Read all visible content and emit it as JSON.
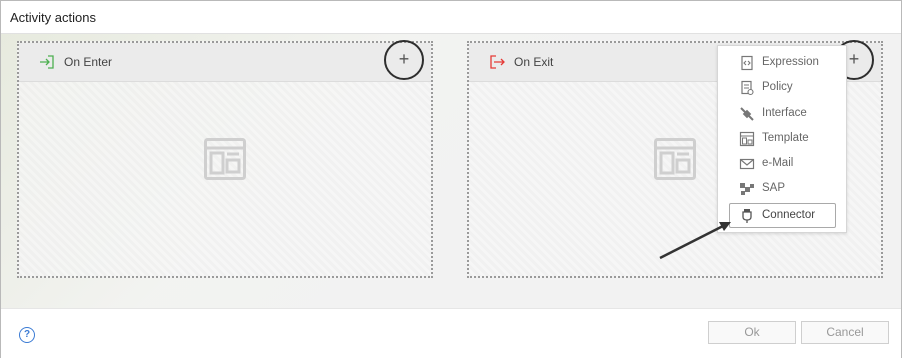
{
  "dialog": {
    "title": "Activity actions"
  },
  "panels": {
    "enter": {
      "label": "On Enter",
      "icon": "enter-arrow-icon",
      "add": "+"
    },
    "exit": {
      "label": "On Exit",
      "icon": "exit-arrow-icon",
      "add": "+"
    }
  },
  "menu": {
    "items": [
      {
        "label": "Expression",
        "icon": "expression-icon"
      },
      {
        "label": "Policy",
        "icon": "policy-icon"
      },
      {
        "label": "Interface",
        "icon": "interface-icon"
      },
      {
        "label": "Template",
        "icon": "template-icon"
      },
      {
        "label": "e-Mail",
        "icon": "email-icon"
      },
      {
        "label": "SAP",
        "icon": "sap-icon"
      },
      {
        "label": "Connector",
        "icon": "connector-icon"
      }
    ]
  },
  "footer": {
    "help": "?",
    "ok": "Ok",
    "cancel": "Cancel"
  },
  "colors": {
    "enter_icon": "#4caf50",
    "exit_icon": "#e53935",
    "help_icon": "#3b7bd4"
  }
}
